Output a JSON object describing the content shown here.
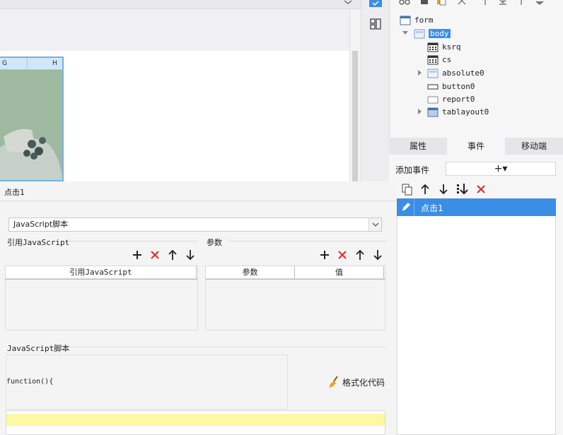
{
  "tree": {
    "nodes": [
      {
        "label": "form"
      },
      {
        "label": "body"
      },
      {
        "label": "ksrq"
      },
      {
        "label": "cs"
      },
      {
        "label": "absolute0"
      },
      {
        "label": "button0"
      },
      {
        "label": "report0"
      },
      {
        "label": "tablayout0"
      }
    ]
  },
  "tabs": [
    {
      "label": "属性"
    },
    {
      "label": "事件"
    },
    {
      "label": "移动端"
    }
  ],
  "sheet": {
    "col_g": "G",
    "col_h": "H"
  },
  "events": {
    "add_label": "添加事件",
    "add_button": "+▾",
    "items": [
      {
        "label": "点击1"
      }
    ]
  },
  "editor": {
    "title": "点击1",
    "type_value": "JavaScript脚本",
    "ref_section": "引用JavaScript",
    "param_section": "参数",
    "ref_table_header": "引用JavaScript",
    "param_col_name": "参数",
    "param_col_value": "值",
    "script_section": "JavaScript脚本",
    "code_line": "function(){",
    "format_button": "格式化代码"
  },
  "colors": {
    "accent": "#3a8ee6",
    "delete": "#e03030",
    "code_highlight": "#fdf8a4"
  }
}
